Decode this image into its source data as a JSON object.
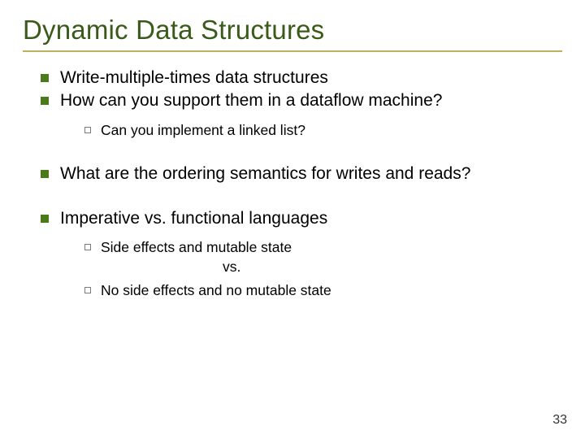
{
  "title": "Dynamic Data Structures",
  "bullets": {
    "b0": "Write-multiple-times data structures",
    "b1": "How can you support them in a dataflow machine?",
    "b1_sub0": "Can you implement a linked list?",
    "b2": "What are the ordering semantics for writes and reads?",
    "b3": "Imperative vs. functional languages",
    "b3_sub0": "Side effects and mutable state",
    "b3_vs": "vs.",
    "b3_sub1": "No side effects and no mutable state"
  },
  "page_number": "33"
}
